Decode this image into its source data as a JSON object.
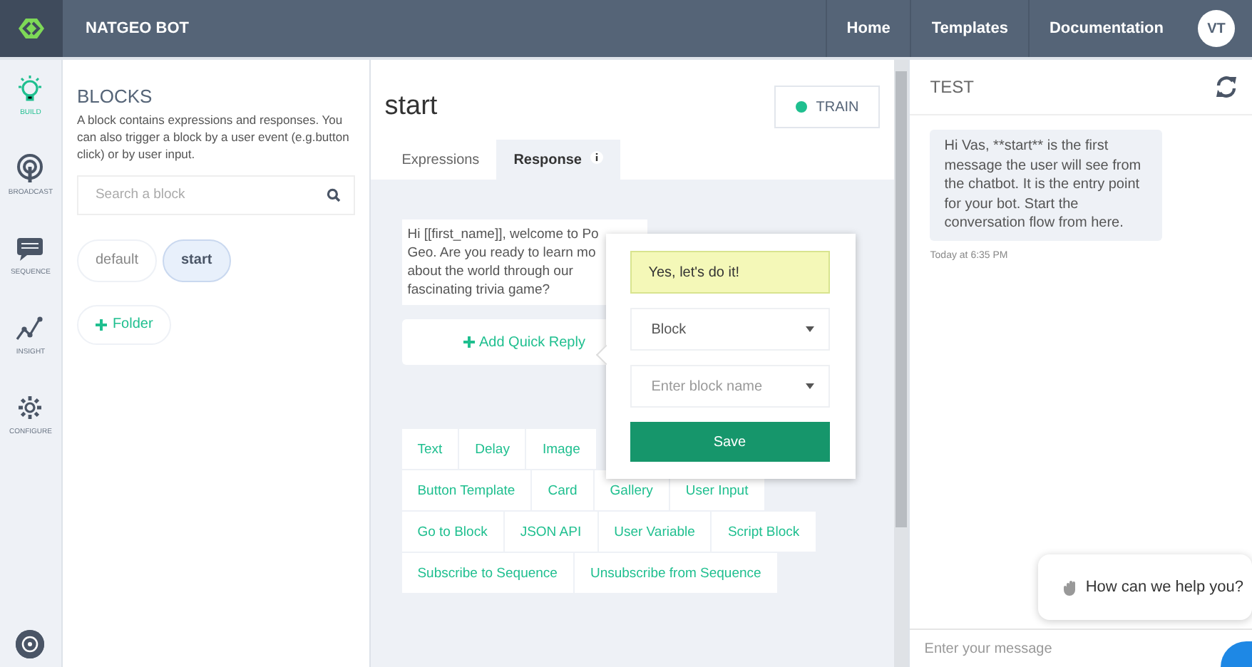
{
  "app": {
    "title": "NATGEO BOT"
  },
  "nav": [
    {
      "label": "Home"
    },
    {
      "label": "Templates"
    },
    {
      "label": "Documentation"
    }
  ],
  "user": {
    "initials": "VT"
  },
  "rail": [
    {
      "label": "BUILD",
      "selected": true
    },
    {
      "label": "BROADCAST",
      "selected": false
    },
    {
      "label": "SEQUENCE",
      "selected": false
    },
    {
      "label": "INSIGHT",
      "selected": false
    },
    {
      "label": "CONFIGURE",
      "selected": false
    }
  ],
  "blocks": {
    "title": "BLOCKS",
    "description": "A block contains expressions and responses. You can also trigger a block by a user event (e.g.button click) or by user input.",
    "search": {
      "placeholder": "Search a block"
    },
    "items": [
      {
        "label": "default",
        "selected": false
      },
      {
        "label": "start",
        "selected": true
      }
    ],
    "add_folder": "Folder"
  },
  "editor": {
    "title": "start",
    "train": "TRAIN",
    "tabs": [
      {
        "label": "Expressions",
        "selected": false
      },
      {
        "label": "Response",
        "selected": true
      }
    ],
    "message": "Hi [[first_name]], welcome to Po\nGeo. Are you ready to learn mo\nabout the world through our\nfascinating trivia game?",
    "add_quick_reply": "Add Quick Reply",
    "components": [
      [
        "Text",
        "Delay",
        "Image"
      ],
      [
        "Button Template",
        "Card",
        "Gallery",
        "User Input"
      ],
      [
        "Go to Block",
        "JSON API",
        "User Variable",
        "Script Block"
      ],
      [
        "Subscribe to Sequence",
        "Unsubscribe from Sequence"
      ]
    ]
  },
  "popup": {
    "reply": "Yes, let's do it!",
    "type": "Block",
    "block_placeholder": "Enter block name",
    "save": "Save"
  },
  "test": {
    "title": "TEST",
    "messages": [
      {
        "text": "Hi Vas, **start** is the first message the user will see from the chatbot. It is the entry point for your bot. Start the conversation flow from here.",
        "time": "Today at 6:35 PM"
      }
    ],
    "input_placeholder": "Enter your message",
    "help": "How can we help you?"
  }
}
